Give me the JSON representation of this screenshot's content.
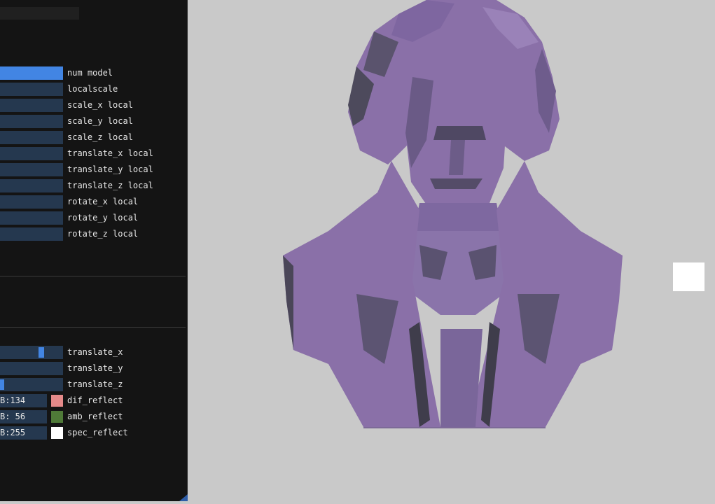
{
  "model_controls": [
    {
      "label": "num model",
      "fill": 1.0
    },
    {
      "label": "localscale",
      "fill": 0
    },
    {
      "label": "scale_x local",
      "fill": 0
    },
    {
      "label": "scale_y local",
      "fill": 0
    },
    {
      "label": "scale_z local",
      "fill": 0
    },
    {
      "label": "translate_x local",
      "fill": 0
    },
    {
      "label": "translate_y local",
      "fill": 0
    },
    {
      "label": "translate_z local",
      "fill": 0
    },
    {
      "label": "rotate_x local",
      "fill": 0
    },
    {
      "label": "rotate_y local",
      "fill": 0
    },
    {
      "label": "rotate_z local",
      "fill": 0
    }
  ],
  "light_controls": [
    {
      "label": "translate_x",
      "value": 0.66
    },
    {
      "label": "translate_y",
      "value": null
    },
    {
      "label": "translate_z",
      "value": 0.0
    }
  ],
  "reflect_controls": [
    {
      "label": "dif_reflect",
      "value_text": "B:134",
      "color": "#e58a8a"
    },
    {
      "label": "amb_reflect",
      "value_text": "B: 56",
      "color": "#4f7a38"
    },
    {
      "label": "spec_reflect",
      "value_text": "B:255",
      "color": "#ffffff"
    }
  ],
  "colors": {
    "viewport_bg": "#c9c9c9",
    "panel_bg": "#141414",
    "slider_bg": "#25384f",
    "slider_accent": "#4285e3",
    "model": "#8a70a8"
  },
  "viewport": {
    "object": "bust-3d-model"
  }
}
